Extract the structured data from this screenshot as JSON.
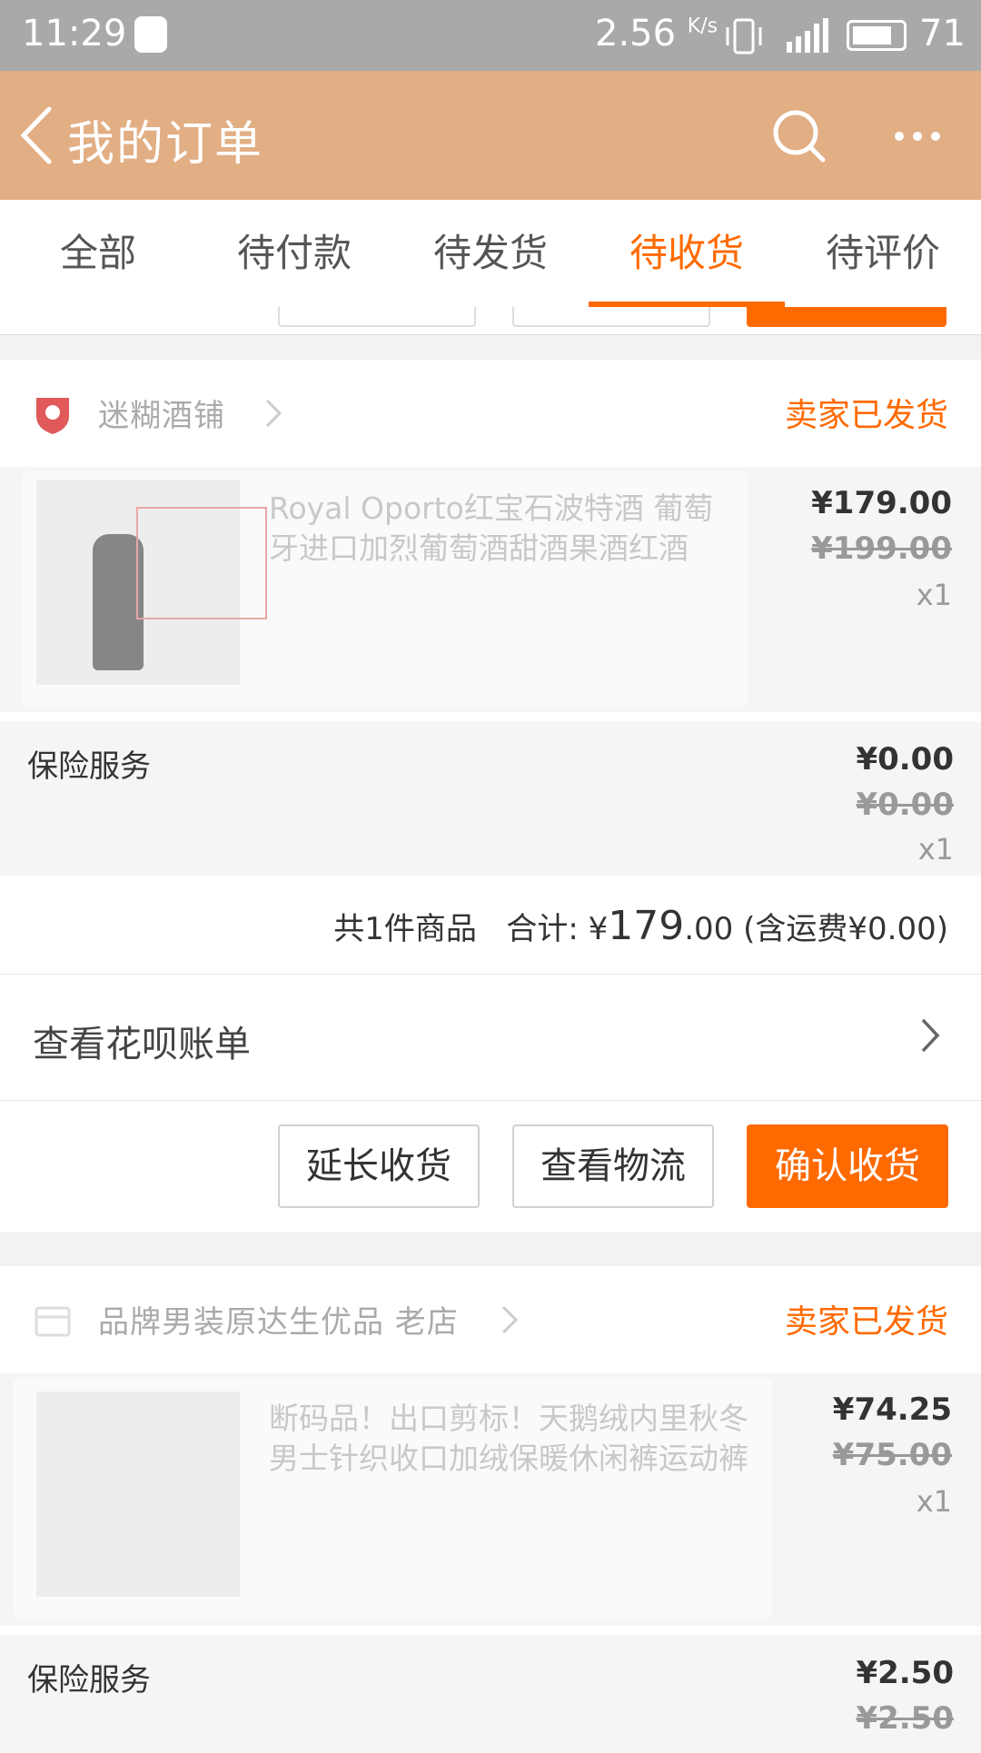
{
  "status_bar": {
    "time": "11:29",
    "net_speed": "2.56",
    "net_speed_unit": "K/s",
    "battery": "71"
  },
  "navbar": {
    "title": "我的订单",
    "back_icon": "chevron-left-icon",
    "search_icon": "search-icon",
    "more_icon": "more-icon"
  },
  "tabs": [
    {
      "label": "全部",
      "active": false
    },
    {
      "label": "待付款",
      "active": false
    },
    {
      "label": "待发货",
      "active": false
    },
    {
      "label": "待收货",
      "active": true
    },
    {
      "label": "待评价",
      "active": false
    }
  ],
  "colors": {
    "accent": "#ff6a00",
    "navbar": "#e2ae84",
    "status_bar": "#a9a9a9"
  },
  "orders": [
    {
      "shop_name": "迷糊酒铺",
      "status": "卖家已发货",
      "item": {
        "title": "Royal Oporto红宝石波特酒 葡萄牙进口加烈葡萄酒甜酒果酒红酒",
        "price": "¥179.00",
        "orig_price": "¥199.00",
        "qty": "x1"
      },
      "insurance": {
        "label": "保险服务",
        "price": "¥0.00",
        "orig_price": "¥0.00",
        "qty": "x1"
      },
      "summary": {
        "count": "共1件商品",
        "total_label": "合计:",
        "currency": "¥",
        "total_int": "179",
        "total_dec": ".00",
        "shipping": "(含运费¥0.00)"
      },
      "huabei": "查看花呗账单",
      "buttons": {
        "extend": "延长收货",
        "logistics": "查看物流",
        "confirm": "确认收货"
      }
    },
    {
      "shop_name": "品牌男装原达生优品 老店",
      "status": "卖家已发货",
      "item": {
        "title": "断码品！出口剪标！天鹅绒内里秋冬男士针织收口加绒保暖休闲裤运动裤",
        "price": "¥74.25",
        "orig_price": "¥75.00",
        "qty": "x1"
      },
      "insurance": {
        "label": "保险服务",
        "price": "¥2.50",
        "orig_price": "¥2.50"
      }
    }
  ]
}
